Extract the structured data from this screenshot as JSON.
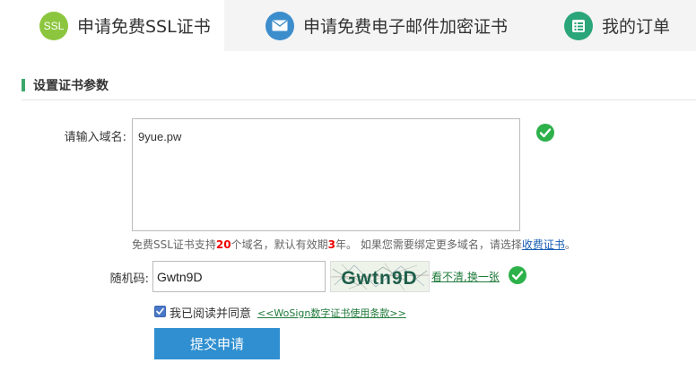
{
  "tabs": [
    {
      "label": "申请免费SSL证书",
      "icon": "ssl-icon",
      "icon_text": "SSL",
      "active": true
    },
    {
      "label": "申请免费电子邮件加密证书",
      "icon": "envelope-icon",
      "active": false
    },
    {
      "label": "我的订单",
      "icon": "list-icon",
      "active": false
    }
  ],
  "section": {
    "title": "设置证书参数"
  },
  "form": {
    "domain_label": "请输入域名:",
    "domain_value": "9yue.pw",
    "hint": {
      "prefix": "免费SSL证书支持",
      "domains_count": "20",
      "middle": "个域名，默认有效期",
      "years": "3",
      "suffix": "年。 如果您需要绑定更多域名，请选择",
      "link": "收费证书",
      "end": "。"
    },
    "captcha_label": "随机码:",
    "captcha_value": "Gwtn9D",
    "captcha_image_text": "Gwtn9D",
    "refresh_link": "看不清,换一张",
    "agree_text": "我已阅读并同意",
    "agree_link": "<<WoSign数字证书使用条款>>",
    "agree_checked": true,
    "submit_label": "提交申请"
  },
  "colors": {
    "accent_green": "#2db14a",
    "ssl_icon": "#8cc63f",
    "mail_icon": "#3c8dcc",
    "order_icon": "#2ba57a",
    "button": "#2f8fd0",
    "section_bar": "#3aa86b",
    "link_green": "#1f7a3a",
    "highlight_red": "#e00000"
  }
}
